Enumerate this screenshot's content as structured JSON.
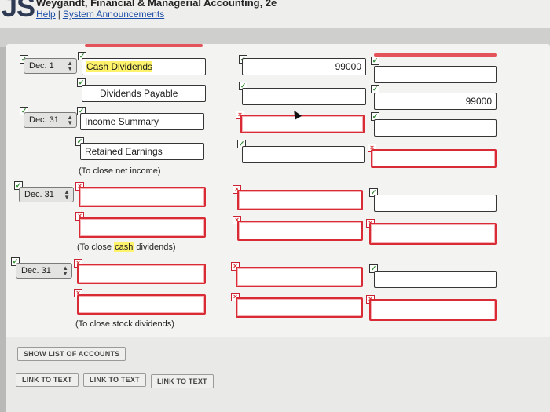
{
  "header": {
    "logo": "JS",
    "title": "Weygandt, Financial & Managerial Accounting, 2e",
    "links": [
      "Help",
      "System Announcements"
    ]
  },
  "entries": {
    "e1": {
      "date": "Dec. 1",
      "debit_account": "Cash Dividends",
      "credit_account": "Dividends Payable",
      "debit_amount": "99000",
      "credit_amount": "99000"
    },
    "e2": {
      "date": "Dec. 31",
      "debit_account": "Income Summary",
      "credit_account": "Retained Earnings",
      "note": "(To close net income)"
    },
    "e3": {
      "date": "Dec. 31",
      "note_pre": "(To close ",
      "note_hl": "cash",
      "note_post": " dividends)"
    },
    "e4": {
      "date": "Dec. 31",
      "note": "(To close stock dividends)"
    }
  },
  "buttons": {
    "show_accounts": "SHOW LIST OF ACCOUNTS",
    "link1": "LINK TO TEXT",
    "link2": "LINK TO TEXT",
    "link3": "LINK TO TEXT"
  },
  "marks": {
    "ok": "✓",
    "bad": "×"
  },
  "colors": {
    "error": "#d92b35",
    "highlight": "#fff36b",
    "link": "#1e4fa8"
  }
}
